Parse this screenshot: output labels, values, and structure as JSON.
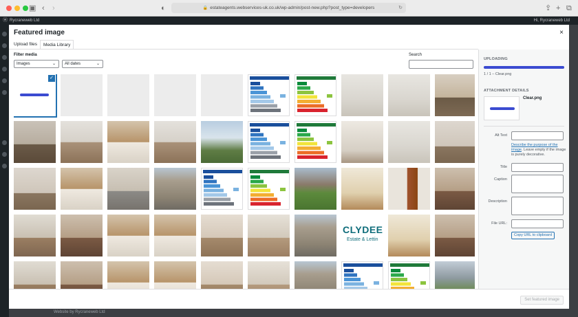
{
  "browser": {
    "url": "estateagents.webservices-uk.co.uk/wp-admin/post-new.php?post_type=developers"
  },
  "wp_admin_bar": {
    "site_name": "Rycraneweb Ltd",
    "howdy": "Hi, Rycraneweb Ltd"
  },
  "footer_note": "Website by Rycraneweb Ltd",
  "modal": {
    "title": "Featured image",
    "close": "×",
    "tabs": [
      "Upload files",
      "Media Library"
    ],
    "filter_label": "Filter media",
    "type_select": "Images",
    "date_select": "All dates",
    "search_label": "Search",
    "search_value": ""
  },
  "sidebar": {
    "uploading_heading": "UPLOADING",
    "upload_progress": 1.0,
    "upload_count": "1 / 1 – Clear.png",
    "attachment_heading": "ATTACHMENT DETAILS",
    "attachment_file": "Clear.png",
    "alt_text_label": "Alt Text",
    "alt_help_link": "Describe the purpose of the image",
    "alt_help_rest": ". Leave empty if the image is purely decorative.",
    "title_label": "Title",
    "caption_label": "Caption",
    "description_label": "Description",
    "file_url_label": "File URL:",
    "copy_url_button": "Copy URL to clipboard"
  },
  "footer": {
    "set_featured_button": "Set featured image"
  },
  "logo": {
    "name": "CLYDEE",
    "sub": "Estate & Lettin"
  },
  "colors": {
    "accent": "#2271b1",
    "upload_bar": "#3b4bd1"
  },
  "grid_rows": [
    [
      "selected-clear",
      "blank",
      "blank",
      "blank",
      "blank",
      "epc-blue",
      "epc-rainbow",
      "bathroom",
      "bathroom",
      "room-window"
    ],
    [
      "room-dark",
      "kitchen",
      "kitchen-wood",
      "kitchen",
      "tower-block",
      "epc-blue",
      "epc-rainbow",
      "hallway",
      "bathroom",
      "room-empty"
    ],
    [
      "room-empty",
      "kitchen-wood",
      "living-fireplace",
      "flats-exterior",
      "epc-blue",
      "epc-rainbow",
      "garden",
      "hallway-wood",
      "hall-door",
      "bedroom"
    ],
    [
      "bedroom-window",
      "bedroom",
      "kitchen-wood",
      "kitchen-wood",
      "living-sofa",
      "living",
      "flats-exterior",
      "logo",
      "hallway-wood",
      "bedroom"
    ],
    [
      "bedroom-window",
      "bedroom",
      "kitchen-wood",
      "kitchen-wood",
      "living-sofa",
      "living",
      "flats-exterior",
      "epc-blue",
      "epc-rainbow",
      "garden-view"
    ]
  ]
}
